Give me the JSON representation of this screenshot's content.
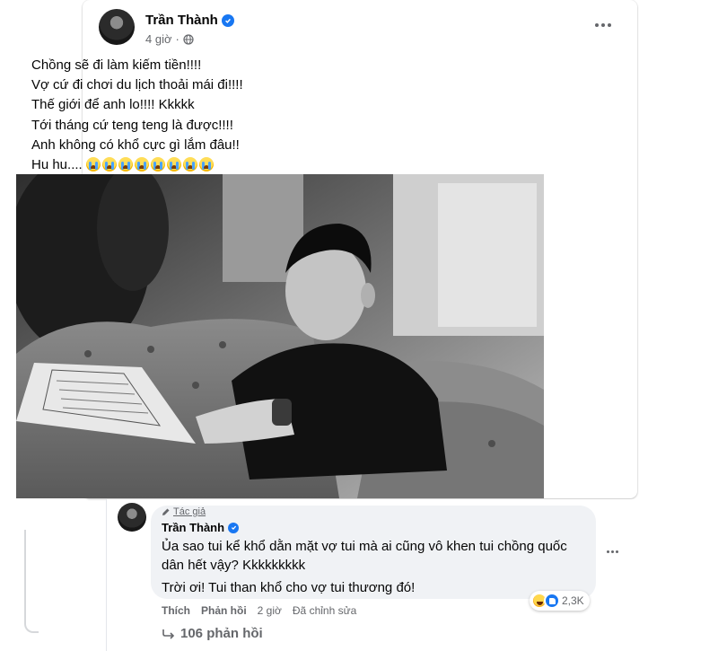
{
  "post": {
    "author": "Trần Thành",
    "time": "4 giờ",
    "privacy_icon": "globe-icon",
    "lines": [
      "Chồng sẽ đi làm kiếm tiền!!!!",
      "Vợ cứ đi chơi du lịch thoải mái đi!!!!",
      "Thế giới để anh lo!!!! Kkkkk",
      "Tới tháng cứ teng teng là được!!!!",
      "Anh không có khổ cực gì lắm đâu!!",
      "Hu hu...."
    ],
    "crying_emoji_count": 8,
    "photo_description_icon": "photo"
  },
  "comment": {
    "tag": "Tác giả",
    "author": "Trần Thành",
    "text_1": "Ủa sao tui kể khổ dằn mặt vợ tui mà ai cũng vô khen tui chồng quốc dân hết vậy? Kkkkkkkkk",
    "text_2": "Trời ơi! Tui than khổ cho vợ tui thương đó!",
    "reaction_count": "2,3K",
    "actions": {
      "like": "Thích",
      "reply": "Phản hồi",
      "time": "2 giờ",
      "edited": "Đã chỉnh sửa"
    },
    "replies_label": "106 phản hồi"
  },
  "colors": {
    "accent": "#1877f2",
    "secondary_text": "#65676b",
    "bubble": "#f0f2f5"
  }
}
